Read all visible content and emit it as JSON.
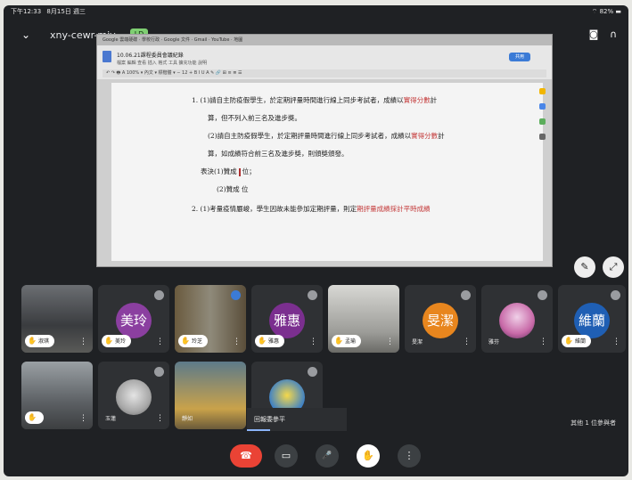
{
  "status": {
    "time": "下午12:33",
    "date": "8月15日 週三",
    "battery": "82%"
  },
  "meeting": {
    "code": "xny-cewr-mjv",
    "live_badge": "LD"
  },
  "doc": {
    "title": "10.06.21課程委員會議紀錄",
    "menu": "檔案 編輯 查看 插入 格式 工具 擴充功能 說明",
    "share_label": "共用",
    "browser_tabs": "Google 雲端硬碟 · 學校行政 · Google 文件 · Gmail · YouTube · 地圖",
    "lines": [
      {
        "prefix": "1. ",
        "text": "(1)請自主防疫假學生，於定期評量時間進行線上同步考試者，成績以",
        "red": "實得分數",
        "suffix": "計"
      },
      {
        "prefix": "",
        "text": "算，但不列入前三名及進步獎。",
        "red": "",
        "suffix": ""
      },
      {
        "prefix": "",
        "text": "(2)請自主防疫假學生，於定期評量時間進行線上同步考試者，成績以",
        "red": "實得分數",
        "suffix": "計"
      },
      {
        "prefix": "",
        "text": "算，如成績符合前三名及進步獎，則頒獎頒發。",
        "red": "",
        "suffix": ""
      },
      {
        "prefix": "",
        "text": "表決(1)贊成",
        "red": "",
        "suffix": "位；"
      },
      {
        "prefix": "",
        "text": "    (2)贊成    位",
        "red": "",
        "suffix": ""
      },
      {
        "prefix": "2. ",
        "text": "(1)考量疫情嚴峻，學生因故未能參加定期評量，則定",
        "red": "期評量成績採計平時成績",
        "suffix": ""
      }
    ]
  },
  "participants_row1": [
    {
      "name": "淑琪",
      "kind": "video",
      "raised": true
    },
    {
      "name": "美玲",
      "kind": "avatar",
      "initials": "美玲",
      "color": "#8b3fa0",
      "raised": true
    },
    {
      "name": "玲芝",
      "kind": "video",
      "raised": true
    },
    {
      "name": "雅惠",
      "kind": "avatar",
      "initials": "雅惠",
      "color": "#7b2f8f",
      "raised": true
    },
    {
      "name": "孟瑜",
      "kind": "video",
      "raised": true
    },
    {
      "name": "旻潔",
      "kind": "avatar",
      "initials": "旻潔",
      "color": "#e8861e",
      "raised": false
    },
    {
      "name": "雅芬",
      "kind": "photo",
      "raised": false
    },
    {
      "name": "維蘭",
      "kind": "avatar",
      "initials": "維蘭",
      "color": "#1f5fb4",
      "raised": true
    }
  ],
  "participants_row2": [
    {
      "name": "",
      "kind": "video",
      "raised": true
    },
    {
      "name": "玉蓮",
      "kind": "photo",
      "raised": false
    },
    {
      "name": "靜如",
      "kind": "video",
      "raised": false
    },
    {
      "name": "",
      "kind": "photo",
      "raised": false
    }
  ],
  "toast": "回報委參平",
  "others_label": "其他 1 位參與者",
  "controls": {
    "hangup": "☎",
    "camera": "▭",
    "mic": "🎤",
    "hand": "✋",
    "more": "⋮"
  }
}
